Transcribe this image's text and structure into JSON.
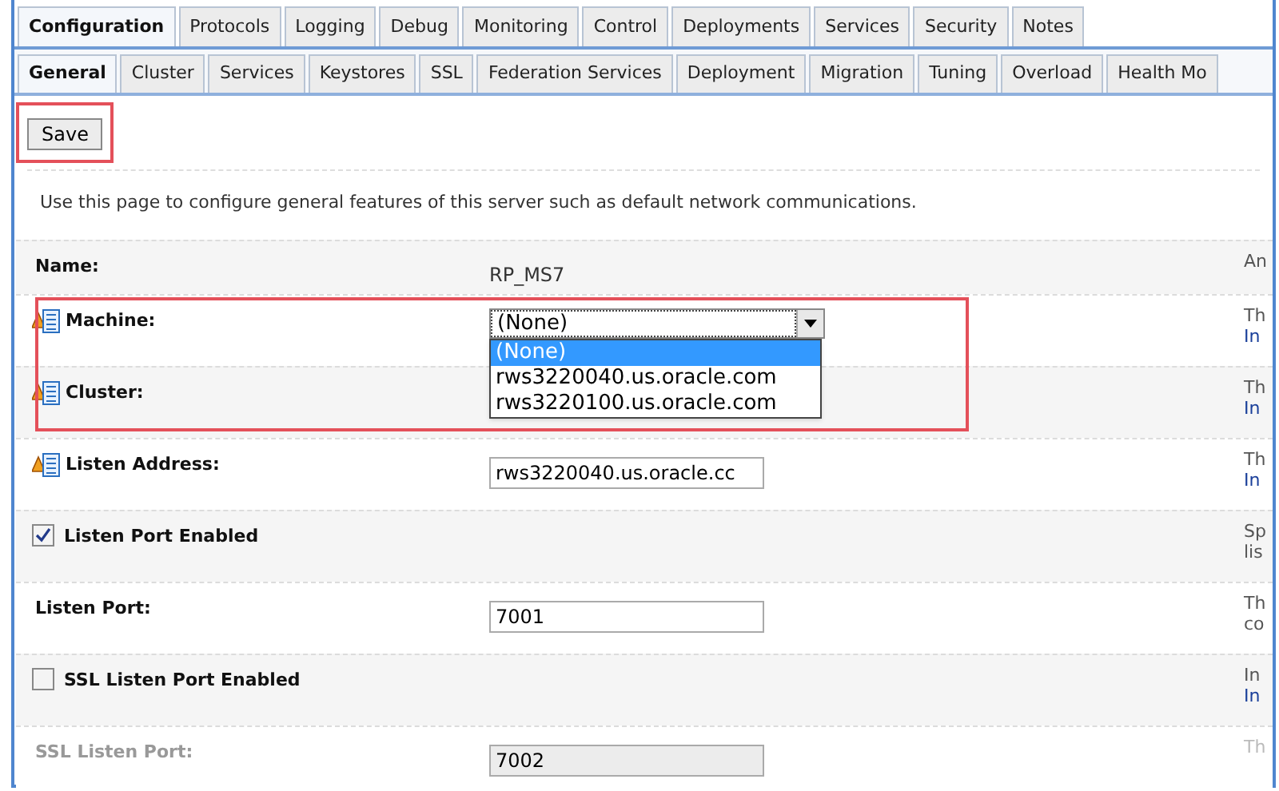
{
  "main_tabs": [
    {
      "label": "Configuration",
      "selected": true
    },
    {
      "label": "Protocols",
      "selected": false
    },
    {
      "label": "Logging",
      "selected": false
    },
    {
      "label": "Debug",
      "selected": false
    },
    {
      "label": "Monitoring",
      "selected": false
    },
    {
      "label": "Control",
      "selected": false
    },
    {
      "label": "Deployments",
      "selected": false
    },
    {
      "label": "Services",
      "selected": false
    },
    {
      "label": "Security",
      "selected": false
    },
    {
      "label": "Notes",
      "selected": false
    }
  ],
  "sub_tabs": [
    {
      "label": "General",
      "selected": true
    },
    {
      "label": "Cluster",
      "selected": false
    },
    {
      "label": "Services",
      "selected": false
    },
    {
      "label": "Keystores",
      "selected": false
    },
    {
      "label": "SSL",
      "selected": false
    },
    {
      "label": "Federation Services",
      "selected": false
    },
    {
      "label": "Deployment",
      "selected": false
    },
    {
      "label": "Migration",
      "selected": false
    },
    {
      "label": "Tuning",
      "selected": false
    },
    {
      "label": "Overload",
      "selected": false
    },
    {
      "label": "Health Mo",
      "selected": false
    }
  ],
  "save_button": {
    "label": "Save",
    "highlighted": true
  },
  "intro": "Use this page to configure general features of this server such as default network communications.",
  "rows": [
    {
      "kind": "text",
      "label": "Name:",
      "value": "RP_MS7",
      "restart_icon": false,
      "highlighted": false,
      "disabled": false,
      "help": [
        {
          "text": "An",
          "link": false
        }
      ]
    },
    {
      "kind": "select",
      "label": "Machine:",
      "value": "(None)",
      "restart_icon": true,
      "highlighted": true,
      "disabled": false,
      "options": [
        {
          "label": "(None)",
          "selected": true
        },
        {
          "label": "rws3220040.us.oracle.com",
          "selected": false
        },
        {
          "label": "rws3220100.us.oracle.com",
          "selected": false
        }
      ],
      "help": [
        {
          "text": "Th",
          "link": false
        },
        {
          "text": "In",
          "link": true
        }
      ]
    },
    {
      "kind": "blank",
      "label": "Cluster:",
      "restart_icon": true,
      "highlighted": true,
      "disabled": false,
      "help": [
        {
          "text": "Th",
          "link": false
        },
        {
          "text": "In",
          "link": true
        }
      ]
    },
    {
      "kind": "input",
      "label": "Listen Address:",
      "value": "rws3220040.us.oracle.cc",
      "restart_icon": true,
      "highlighted": false,
      "disabled": false,
      "help": [
        {
          "text": "Th",
          "link": false
        },
        {
          "text": "In",
          "link": true
        }
      ]
    },
    {
      "kind": "checkbox",
      "label": "Listen Port Enabled",
      "checked": true,
      "restart_icon": false,
      "highlighted": false,
      "disabled": false,
      "help": [
        {
          "text": "Sp",
          "link": false
        },
        {
          "text": "lis",
          "link": false
        }
      ]
    },
    {
      "kind": "input",
      "label": "Listen Port:",
      "value": "7001",
      "restart_icon": false,
      "highlighted": false,
      "disabled": false,
      "help": [
        {
          "text": "Th",
          "link": false
        },
        {
          "text": "co",
          "link": false
        }
      ]
    },
    {
      "kind": "checkbox",
      "label": "SSL Listen Port Enabled",
      "checked": false,
      "restart_icon": false,
      "highlighted": false,
      "disabled": false,
      "help": [
        {
          "text": "In",
          "link": false
        },
        {
          "text": "In",
          "link": true
        }
      ]
    },
    {
      "kind": "input",
      "label": "SSL Listen Port:",
      "value": "7002",
      "restart_icon": false,
      "highlighted": false,
      "disabled": true,
      "help": [
        {
          "text": "Th",
          "link": false
        }
      ]
    }
  ]
}
